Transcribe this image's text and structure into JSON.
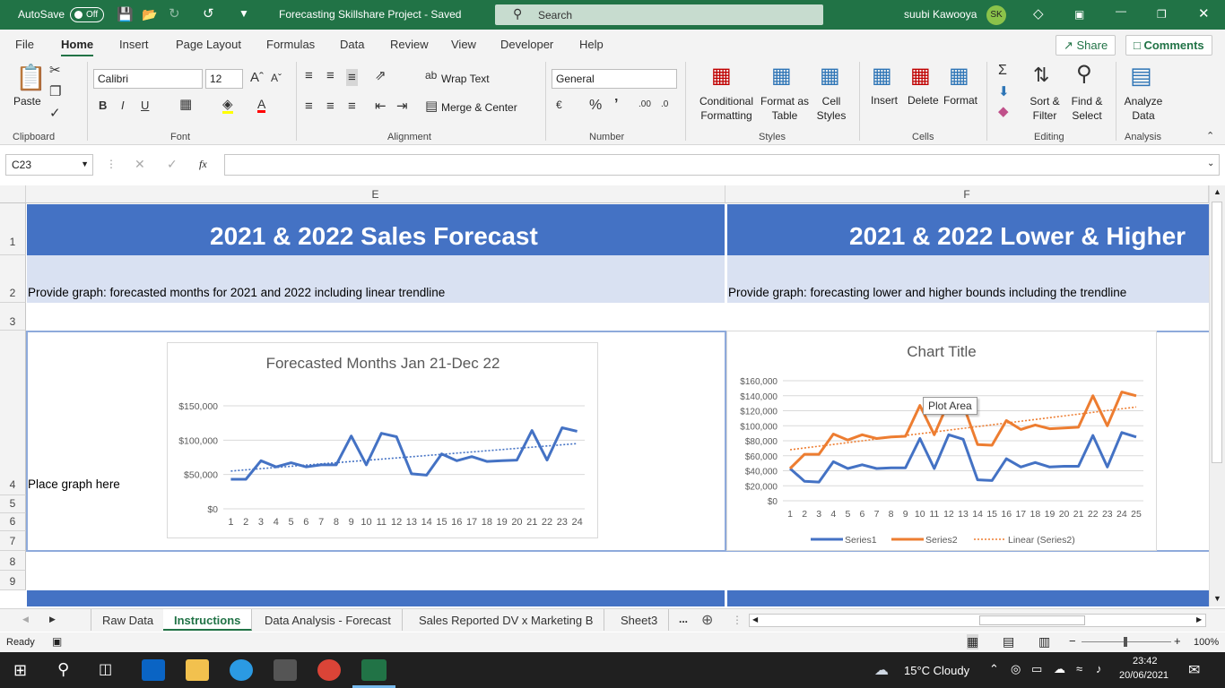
{
  "titlebar": {
    "autosave_label": "AutoSave",
    "autosave_state": "Off",
    "doc_title": "Forecasting Skillshare Project  -  Saved",
    "search_placeholder": "Search",
    "user_name": "suubi Kawooya",
    "user_initials": "SK"
  },
  "ribbon_tabs": [
    "File",
    "Home",
    "Insert",
    "Page Layout",
    "Formulas",
    "Data",
    "Review",
    "View",
    "Developer",
    "Help"
  ],
  "share_label": "Share",
  "comments_label": "Comments",
  "ribbon": {
    "paste": "Paste",
    "font_name": "Calibri",
    "font_size": "12",
    "wrap_text": "Wrap Text",
    "merge_center": "Merge & Center",
    "number_format": "General",
    "conditional_formatting": "Conditional Formatting",
    "format_as_table": "Format as Table",
    "cell_styles": "Cell Styles",
    "insert": "Insert",
    "delete": "Delete",
    "format": "Format",
    "sort_filter": "Sort & Filter",
    "find_select": "Find & Select",
    "analyze_data": "Analyze Data",
    "groups": {
      "clipboard": "Clipboard",
      "font": "Font",
      "alignment": "Alignment",
      "number": "Number",
      "styles": "Styles",
      "cells": "Cells",
      "editing": "Editing",
      "analysis": "Analysis"
    }
  },
  "formula_bar": {
    "name_box": "C23",
    "fx": "fx",
    "formula": ""
  },
  "columns": [
    "E",
    "F"
  ],
  "rows": [
    "1",
    "2",
    "3",
    "4",
    "5",
    "6",
    "7",
    "8",
    "9"
  ],
  "cells": {
    "e1": "2021 & 2022 Sales Forecast",
    "f1": "2021 & 2022 Lower & Higher",
    "e2": "Provide graph: forecasted months for 2021 and 2022 including linear trendline",
    "f2": "Provide graph: forecasting lower and higher bounds including the trendline",
    "e4": "Place graph here"
  },
  "colors": {
    "excel_green": "#217346",
    "header_blue": "#4472c4",
    "light_blue": "#d9e1f2",
    "series_blue": "#4472c4",
    "series_orange": "#ed7d31"
  },
  "chart_data": [
    {
      "type": "line",
      "title": "Forecasted Months Jan 21-Dec 22",
      "xlabel": "",
      "ylabel": "",
      "x": [
        1,
        2,
        3,
        4,
        5,
        6,
        7,
        8,
        9,
        10,
        11,
        12,
        13,
        14,
        15,
        16,
        17,
        18,
        19,
        20,
        21,
        22,
        23,
        24
      ],
      "series": [
        {
          "values": [
            43000,
            43000,
            70000,
            61000,
            67000,
            61000,
            64000,
            64000,
            106000,
            64000,
            110000,
            105000,
            51000,
            49000,
            80000,
            70000,
            76000,
            69000,
            70000,
            71000,
            114000,
            71000,
            118000,
            113000
          ]
        }
      ],
      "trendline": {
        "type": "linear",
        "start": 55000,
        "end": 95000
      },
      "ylim": [
        0,
        150000
      ],
      "yticks": [
        "$0",
        "$50,000",
        "$100,000",
        "$150,000"
      ],
      "grid": true,
      "legend": "none"
    },
    {
      "type": "line",
      "title": "Chart Title",
      "xlabel": "",
      "ylabel": "",
      "x": [
        1,
        2,
        3,
        4,
        5,
        6,
        7,
        8,
        9,
        10,
        11,
        12,
        13,
        14,
        15,
        16,
        17,
        18,
        19,
        20,
        21,
        22,
        23,
        24,
        25
      ],
      "series": [
        {
          "name": "Series1",
          "values": [
            43000,
            26000,
            25000,
            52000,
            43000,
            48000,
            43000,
            44000,
            44000,
            83000,
            43000,
            88000,
            82000,
            28000,
            27000,
            56000,
            45000,
            51000,
            45000,
            46000,
            46000,
            87000,
            45000,
            91000,
            85000
          ]
        },
        {
          "name": "Series2",
          "values": [
            43000,
            62000,
            62000,
            89000,
            81000,
            88000,
            83000,
            85000,
            86000,
            127000,
            88000,
            132000,
            128000,
            75000,
            74000,
            107000,
            95000,
            101000,
            96000,
            97000,
            98000,
            140000,
            100000,
            145000,
            140000
          ]
        }
      ],
      "trendline": {
        "name": "Linear (Series2)",
        "type": "linear",
        "start": 68000,
        "end": 125000
      },
      "ylim": [
        0,
        160000
      ],
      "yticks": [
        "$0",
        "$20,000",
        "$40,000",
        "$60,000",
        "$80,000",
        "$100,000",
        "$120,000",
        "$140,000",
        "$160,000"
      ],
      "tooltip": "Plot Area",
      "grid": true,
      "legend": "bottom"
    }
  ],
  "sheet_tabs": [
    "Raw Data",
    "Instructions",
    "Data Analysis - Forecast",
    "Sales Reported DV x Marketing B",
    "Sheet3"
  ],
  "active_sheet": "Instructions",
  "more_tabs": "...",
  "status": {
    "ready": "Ready",
    "zoom": "100%"
  },
  "taskbar": {
    "weather": "15°C  Cloudy",
    "time": "23:42",
    "date": "20/06/2021"
  }
}
